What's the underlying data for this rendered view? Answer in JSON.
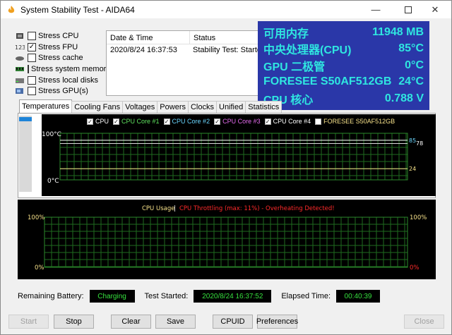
{
  "window": {
    "title": "System Stability Test - AIDA64",
    "minimize_icon": "minimize-icon",
    "maximize_icon": "maximize-icon",
    "close_icon": "close-icon"
  },
  "stress_options": [
    {
      "label": "Stress CPU",
      "checked": false
    },
    {
      "label": "Stress FPU",
      "checked": true
    },
    {
      "label": "Stress cache",
      "checked": false
    },
    {
      "label": "Stress system memory",
      "checked": false
    },
    {
      "label": "Stress local disks",
      "checked": false
    },
    {
      "label": "Stress GPU(s)",
      "checked": false
    }
  ],
  "status_table": {
    "headers": [
      "Date & Time",
      "Status"
    ],
    "rows": [
      [
        "2020/8/24 16:37:53",
        "Stability Test: Started"
      ]
    ]
  },
  "overlay": {
    "rows": [
      {
        "label": "可用内存",
        "value": "11948 MB"
      },
      {
        "label": "中央处理器(CPU)",
        "value": "85°C"
      },
      {
        "label": "GPU 二极管",
        "value": "0°C"
      },
      {
        "label": "FORESEE S50AF512GB",
        "value": "24°C"
      },
      {
        "label": "CPU 核心",
        "value": "0.788 V"
      }
    ]
  },
  "tabs": [
    "Temperatures",
    "Cooling Fans",
    "Voltages",
    "Powers",
    "Clocks",
    "Unified",
    "Statistics"
  ],
  "temp_graph": {
    "legend": [
      {
        "label": "CPU",
        "checked": true,
        "color": "#ffffff"
      },
      {
        "label": "CPU Core #1",
        "checked": true,
        "color": "#5fe35f"
      },
      {
        "label": "CPU Core #2",
        "checked": true,
        "color": "#6ad6ff"
      },
      {
        "label": "CPU Core #3",
        "checked": true,
        "color": "#e66cf0"
      },
      {
        "label": "CPU Core #4",
        "checked": true,
        "color": "#ffffff"
      },
      {
        "label": "FORESEE S50AF512GB",
        "checked": false,
        "color": "#f7e28a"
      }
    ],
    "y_max_label": "100°C",
    "y_min_label": "0°C",
    "readout_a": "85",
    "readout_b": "78",
    "readout_c": "24"
  },
  "chart_data": {
    "type": "line",
    "title": "",
    "xlabel": "",
    "ylabel": "",
    "ylim": [
      0,
      100
    ],
    "series": [
      {
        "name": "CPU",
        "values": [
          85,
          85,
          85,
          85,
          85,
          85,
          85,
          85,
          85,
          85
        ]
      },
      {
        "name": "CPU Core #4",
        "values": [
          78,
          78,
          78,
          78,
          78,
          78,
          78,
          78,
          78,
          78
        ]
      },
      {
        "name": "FORESEE S50AF512GB",
        "values": [
          24,
          24,
          24,
          24,
          24,
          24,
          24,
          24,
          24,
          24
        ]
      }
    ]
  },
  "usage_graph": {
    "title_usage": "CPU Usage",
    "separator": "|",
    "title_throttle": "CPU Throttling (max: 11%) - Overheating Detected!",
    "y_max_left": "100%",
    "y_min_left": "0%",
    "y_max_right": "100%",
    "y_min_right": "0%",
    "usage_color": "#f7e28a",
    "throttle_color": "#ff2a2a"
  },
  "bottom_info": {
    "battery_label": "Remaining Battery:",
    "battery_value": "Charging",
    "started_label": "Test Started:",
    "started_value": "2020/8/24 16:37:52",
    "elapsed_label": "Elapsed Time:",
    "elapsed_value": "00:40:39"
  },
  "buttons": {
    "start": "Start",
    "stop": "Stop",
    "clear": "Clear",
    "save": "Save",
    "cpuid": "CPUID",
    "preferences": "Preferences",
    "close": "Close"
  }
}
